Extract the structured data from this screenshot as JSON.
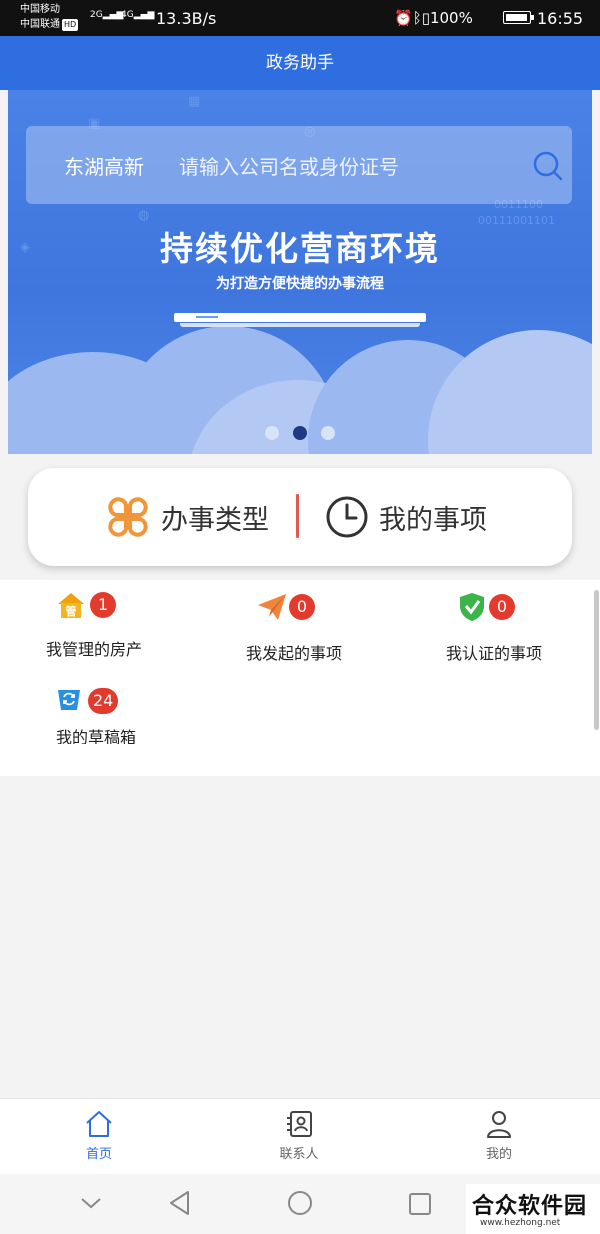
{
  "status_bar": {
    "carrier_1": "中国移动",
    "carrier_2": "中国联通",
    "hd_badge": "HD",
    "signal_1": "2G",
    "signal_2": "4G",
    "net_speed": "13.3B/s",
    "battery": "100%",
    "time": "16:55"
  },
  "header": {
    "title": "政务助手"
  },
  "banner": {
    "location": "东湖高新",
    "search_placeholder": "请输入公司名或身份证号",
    "headline": "持续优化营商环境",
    "subheadline": "为打造方便快捷的办事流程",
    "page_count": 3,
    "active_page": 2
  },
  "entries": {
    "type_label": "办事类型",
    "mine_label": "我的事项"
  },
  "items": [
    {
      "label": "我管理的房产",
      "count": "1",
      "icon": "house-icon",
      "icon_text": "管"
    },
    {
      "label": "我发起的事项",
      "count": "0",
      "icon": "paper-plane-icon"
    },
    {
      "label": "我认证的事项",
      "count": "0",
      "icon": "shield-check-icon"
    },
    {
      "label": "我的草稿箱",
      "count": "24",
      "icon": "draft-box-icon"
    }
  ],
  "bottom_nav": [
    {
      "label": "首页",
      "icon": "home-icon",
      "active": true
    },
    {
      "label": "联系人",
      "icon": "contacts-icon",
      "active": false
    },
    {
      "label": "我的",
      "icon": "person-icon",
      "active": false
    }
  ],
  "watermark": {
    "text": "合众软件园",
    "url": "www.hezhong.net"
  },
  "colors": {
    "primary": "#2f6ee0",
    "badge": "#e23b2e",
    "divider": "#e05a4e",
    "type_icon": "#f0953a"
  }
}
